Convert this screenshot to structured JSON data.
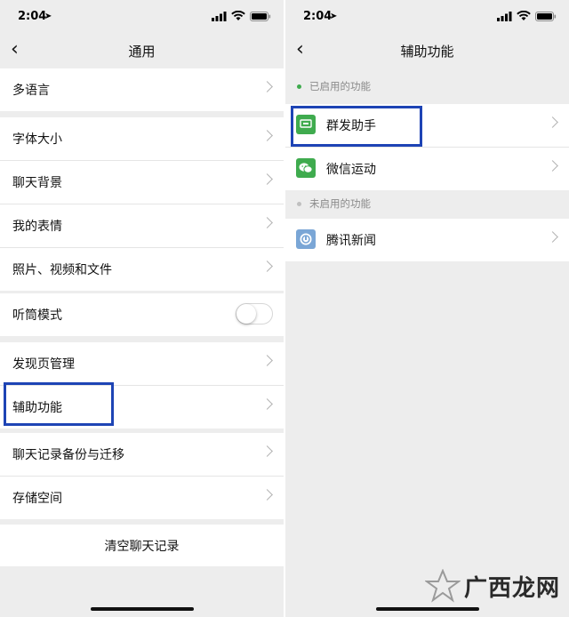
{
  "status": {
    "time": "2:04"
  },
  "left": {
    "title": "通用",
    "groups": [
      [
        {
          "label": "多语言"
        }
      ],
      [
        {
          "label": "字体大小"
        },
        {
          "label": "聊天背景"
        },
        {
          "label": "我的表情"
        },
        {
          "label": "照片、视频和文件"
        }
      ],
      [
        {
          "label": "听筒模式",
          "toggle": false
        }
      ],
      [
        {
          "label": "发现页管理"
        },
        {
          "label": "辅助功能"
        }
      ],
      [
        {
          "label": "聊天记录备份与迁移"
        },
        {
          "label": "存储空间"
        }
      ]
    ],
    "clear_button": "清空聊天记录"
  },
  "right": {
    "title": "辅助功能",
    "enabled_header": "已启用的功能",
    "enabled_items": [
      {
        "label": "群发助手",
        "icon": "mass-message-icon",
        "color": "#3fab4e"
      },
      {
        "label": "微信运动",
        "icon": "wechat-sport-icon",
        "color": "#3fab4e"
      }
    ],
    "disabled_header": "未启用的功能",
    "disabled_items": [
      {
        "label": "腾讯新闻",
        "icon": "tencent-news-icon",
        "color": "#7aa6d6"
      }
    ]
  },
  "watermark": {
    "text": "广西龙网"
  },
  "colors": {
    "highlight": "#1e44b5",
    "enabled_dot": "#3fab4e",
    "disabled_dot": "#c0c0c0"
  }
}
